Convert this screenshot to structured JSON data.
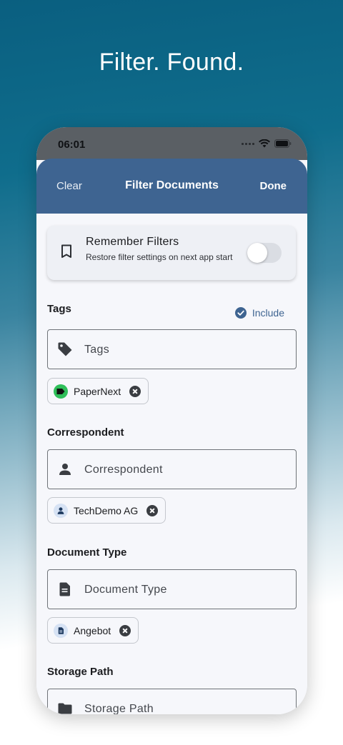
{
  "headline": "Filter. Found.",
  "status_bar": {
    "time": "06:01",
    "icons": [
      "signal-icon",
      "wifi-icon",
      "battery-icon"
    ]
  },
  "app_bar": {
    "left_action": "Clear",
    "title": "Filter Documents",
    "right_action": "Done"
  },
  "remember_filters": {
    "title": "Remember Filters",
    "subtitle": "Restore filter settings on next app start",
    "toggle_on": false
  },
  "sections": {
    "tags": {
      "title": "Tags",
      "mode_label": "Include",
      "placeholder": "Tags",
      "chip": {
        "label": "PaperNext",
        "color": "#2fbf5a"
      }
    },
    "correspondent": {
      "title": "Correspondent",
      "placeholder": "Correspondent",
      "chip": {
        "label": "TechDemo AG"
      }
    },
    "document_type": {
      "title": "Document Type",
      "placeholder": "Document Type",
      "chip": {
        "label": "Angebot"
      }
    },
    "storage_path": {
      "title": "Storage Path",
      "placeholder": "Storage Path"
    }
  },
  "colors": {
    "primary": "#3e6491",
    "background": "#f6f7fb"
  }
}
